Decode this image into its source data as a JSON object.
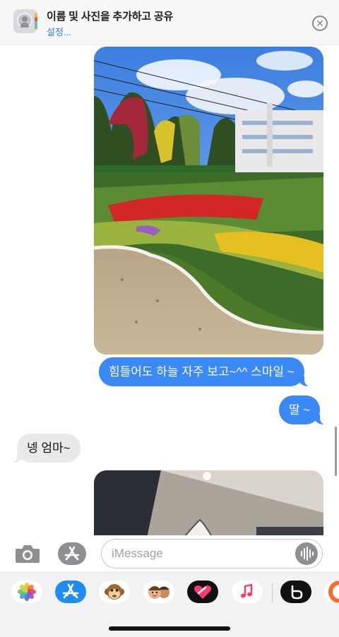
{
  "banner": {
    "title": "이름 및 사진을 추가하고 공유",
    "link": "설정...",
    "close_glyph": "✕",
    "icon": "contacts-icon"
  },
  "messages": [
    {
      "direction": "outgoing",
      "text": "힘들어도 하늘 자주 보고~^^ 스마일 ~"
    },
    {
      "direction": "outgoing",
      "text": "딸 ~"
    },
    {
      "direction": "incoming",
      "text": "넹 엄마~"
    }
  ],
  "input": {
    "placeholder": "iMessage"
  },
  "drawer_apps": [
    "photos-app-icon",
    "app-store-app-icon",
    "animoji-app-icon",
    "memoji-app-icon",
    "digital-touch-app-icon",
    "music-app-icon",
    "bubble-app-icon",
    "partial-app-icon"
  ],
  "colors": {
    "outgoing_bubble": "#3b89f5",
    "incoming_bubble": "#e9e9eb",
    "link": "#2f7cf6"
  }
}
